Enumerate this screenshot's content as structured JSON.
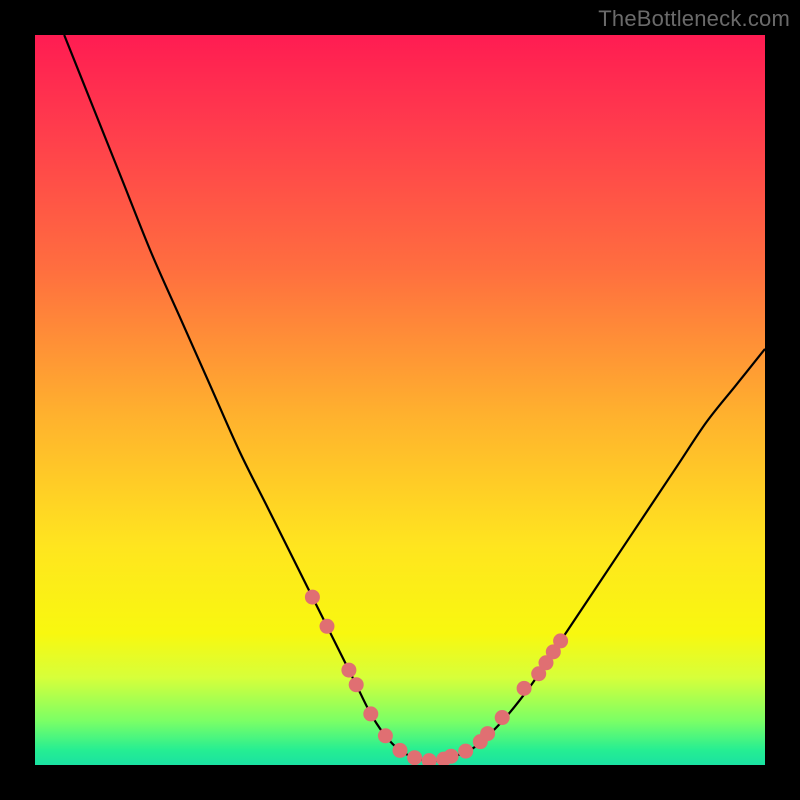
{
  "watermark": "TheBottleneck.com",
  "colors": {
    "frame": "#000000",
    "gradient_top": "#ff1c52",
    "gradient_mid1": "#ff6e3f",
    "gradient_mid2": "#ffe51f",
    "gradient_bottom": "#1ae2a2",
    "curve": "#000000",
    "marker_fill": "#e06f72",
    "marker_stroke": "#d85e62"
  },
  "chart_data": {
    "type": "line",
    "title": "",
    "xlabel": "",
    "ylabel": "",
    "xlim": [
      0,
      100
    ],
    "ylim": [
      0,
      100
    ],
    "grid": false,
    "legend": false,
    "series": [
      {
        "name": "curve",
        "x": [
          4,
          8,
          12,
          16,
          20,
          24,
          28,
          32,
          36,
          38,
          40,
          42,
          44,
          46,
          48,
          50,
          52,
          54,
          56,
          60,
          64,
          68,
          72,
          76,
          80,
          84,
          88,
          92,
          96,
          100
        ],
        "y": [
          100,
          90,
          80,
          70,
          61,
          52,
          43,
          35,
          27,
          23,
          19,
          15,
          11,
          7,
          4,
          2,
          1,
          0.6,
          0.8,
          2.3,
          6,
          11,
          17,
          23,
          29,
          35,
          41,
          47,
          52,
          57
        ]
      }
    ],
    "markers": [
      {
        "x": 38,
        "y": 23
      },
      {
        "x": 40,
        "y": 19
      },
      {
        "x": 43,
        "y": 13
      },
      {
        "x": 44,
        "y": 11
      },
      {
        "x": 46,
        "y": 7
      },
      {
        "x": 48,
        "y": 4
      },
      {
        "x": 50,
        "y": 2
      },
      {
        "x": 52,
        "y": 1
      },
      {
        "x": 54,
        "y": 0.6
      },
      {
        "x": 56,
        "y": 0.8
      },
      {
        "x": 57,
        "y": 1.2
      },
      {
        "x": 59,
        "y": 1.9
      },
      {
        "x": 61,
        "y": 3.2
      },
      {
        "x": 62,
        "y": 4.3
      },
      {
        "x": 64,
        "y": 6.5
      },
      {
        "x": 67,
        "y": 10.5
      },
      {
        "x": 69,
        "y": 12.5
      },
      {
        "x": 70,
        "y": 14
      },
      {
        "x": 71,
        "y": 15.5
      },
      {
        "x": 72,
        "y": 17
      }
    ]
  }
}
